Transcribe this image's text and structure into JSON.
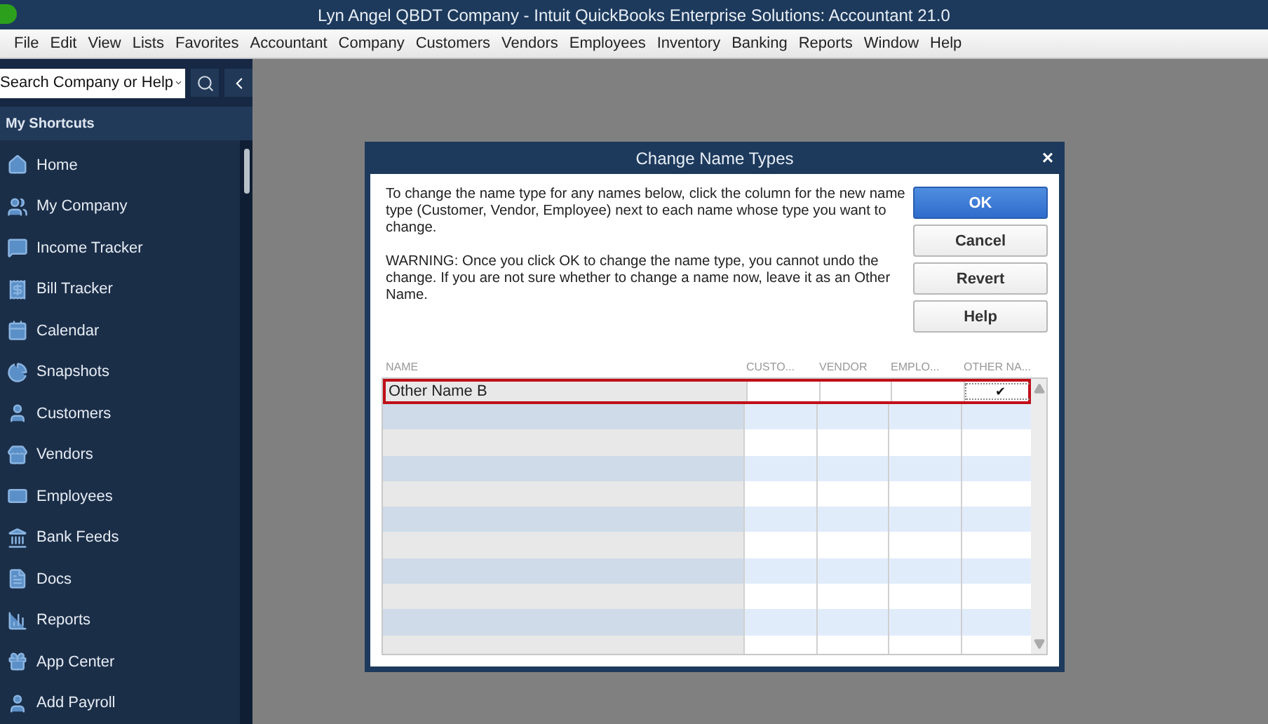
{
  "window": {
    "title": "Lyn Angel QBDT Company  - Intuit QuickBooks Enterprise Solutions: Accountant 21.0"
  },
  "menu": [
    "File",
    "Edit",
    "View",
    "Lists",
    "Favorites",
    "Accountant",
    "Company",
    "Customers",
    "Vendors",
    "Employees",
    "Inventory",
    "Banking",
    "Reports",
    "Window",
    "Help"
  ],
  "search": {
    "value": "Search Company or Help"
  },
  "sidebar": {
    "title": "My Shortcuts",
    "items": [
      {
        "label": "Home"
      },
      {
        "label": "My Company"
      },
      {
        "label": "Income Tracker"
      },
      {
        "label": "Bill Tracker"
      },
      {
        "label": "Calendar"
      },
      {
        "label": "Snapshots"
      },
      {
        "label": "Customers"
      },
      {
        "label": "Vendors"
      },
      {
        "label": "Employees"
      },
      {
        "label": "Bank Feeds"
      },
      {
        "label": "Docs"
      },
      {
        "label": "Reports"
      },
      {
        "label": "App Center"
      },
      {
        "label": "Add Payroll"
      }
    ]
  },
  "dialog": {
    "title": "Change Name Types",
    "close": "×",
    "instructions": "To change the name type for any names below, click the column for the new name type (Customer, Vendor, Employee) next to each name whose type you want to change.",
    "warning": "WARNING: Once you click OK to change the name type, you cannot undo the change. If you are not sure whether to change a name now, leave it as an Other Name.",
    "buttons": [
      {
        "label": "OK",
        "primary": true
      },
      {
        "label": "Cancel",
        "primary": false
      },
      {
        "label": "Revert",
        "primary": false
      },
      {
        "label": "Help",
        "primary": false
      }
    ],
    "table": {
      "columns": [
        "NAME",
        "CUSTO...",
        "VENDOR",
        "EMPLO...",
        "OTHER NA..."
      ],
      "rows": [
        {
          "name": "Other Name B",
          "selected": true,
          "checks": [
            {
              "checked": false
            },
            {
              "checked": false
            },
            {
              "checked": false
            },
            {
              "checked": true,
              "mark": "✔"
            }
          ]
        }
      ]
    }
  }
}
